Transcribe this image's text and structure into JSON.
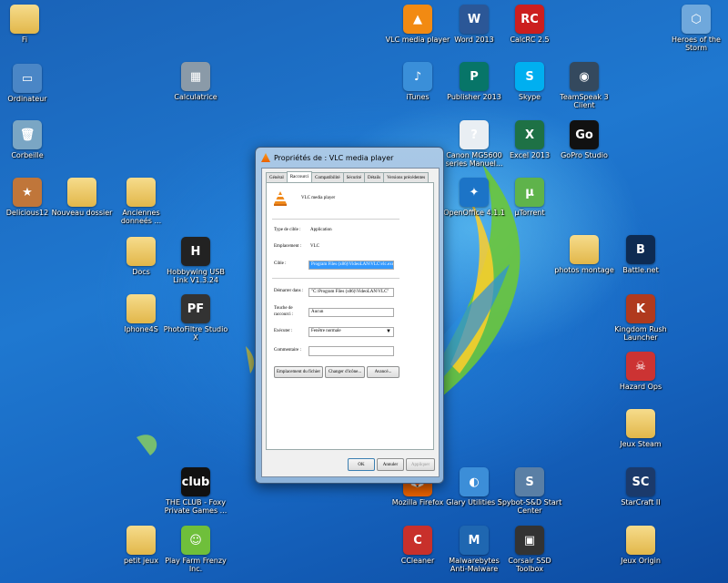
{
  "desktop": {
    "icons": [
      {
        "label": "Fi",
        "x": 0,
        "y": 0
      },
      {
        "label": "Ordinateur",
        "x": 0,
        "y": 0
      },
      {
        "label": "Corbeille",
        "x": 0,
        "y": 0
      },
      {
        "label": "Delicious12",
        "x": 0,
        "y": 0
      },
      {
        "label": "Nouveau dossier",
        "x": 0,
        "y": 0
      },
      {
        "label": "Anciennes donneés ...",
        "x": 0,
        "y": 0
      },
      {
        "label": "Docs",
        "x": 0,
        "y": 0
      },
      {
        "label": "Iphone4S",
        "x": 0,
        "y": 0
      },
      {
        "label": "Calculatrice",
        "x": 0,
        "y": 0
      },
      {
        "label": "Hobbywing USB Link V1.3.24",
        "x": 0,
        "y": 0
      },
      {
        "label": "PhotoFiltre Studio X",
        "x": 0,
        "y": 0
      },
      {
        "label": "VLC media player",
        "x": 0,
        "y": 0
      },
      {
        "label": "Word 2013",
        "x": 0,
        "y": 0
      },
      {
        "label": "CalcRC 2.5",
        "x": 0,
        "y": 0
      },
      {
        "label": "iTunes",
        "x": 0,
        "y": 0
      },
      {
        "label": "Publisher 2013",
        "x": 0,
        "y": 0
      },
      {
        "label": "Skype",
        "x": 0,
        "y": 0
      },
      {
        "label": "TeamSpeak 3 Client",
        "x": 0,
        "y": 0
      },
      {
        "label": "Canon MG5600 series Manuel...",
        "x": 0,
        "y": 0
      },
      {
        "label": "Excel 2013",
        "x": 0,
        "y": 0
      },
      {
        "label": "GoPro Studio",
        "x": 0,
        "y": 0
      },
      {
        "label": "OpenOffice 4.1.1",
        "x": 0,
        "y": 0
      },
      {
        "label": "µTorrent",
        "x": 0,
        "y": 0
      },
      {
        "label": "Heroes of the Storm",
        "x": 0,
        "y": 0
      },
      {
        "label": "photos montage",
        "x": 0,
        "y": 0
      },
      {
        "label": "Battle.net",
        "x": 0,
        "y": 0
      },
      {
        "label": "Kingdom Rush Launcher",
        "x": 0,
        "y": 0
      },
      {
        "label": "Hazard Ops",
        "x": 0,
        "y": 0
      },
      {
        "label": "Jeux Steam",
        "x": 0,
        "y": 0
      },
      {
        "label": "StarCraft II",
        "x": 0,
        "y": 0
      },
      {
        "label": "Jeux Origin",
        "x": 0,
        "y": 0
      },
      {
        "label": "THE CLUB - Foxy Private Games ...",
        "x": 0,
        "y": 0
      },
      {
        "label": "petit jeux",
        "x": 0,
        "y": 0
      },
      {
        "label": "Play Farm Frenzy Inc.",
        "x": 0,
        "y": 0
      },
      {
        "label": "Mozilla Firefox",
        "x": 0,
        "y": 0
      },
      {
        "label": "Glary Utilities 5",
        "x": 0,
        "y": 0
      },
      {
        "label": "Spybot-S&D Start Center",
        "x": 0,
        "y": 0
      },
      {
        "label": "CCleaner",
        "x": 0,
        "y": 0
      },
      {
        "label": "Malwarebytes Anti-Malware",
        "x": 0,
        "y": 0
      },
      {
        "label": "Corsair SSD Toolbox",
        "x": 0,
        "y": 0
      }
    ]
  },
  "dialog": {
    "title": "Propriétés de : VLC media player",
    "tabs": [
      "Général",
      "Raccourci",
      "Compatibilité",
      "Sécurité",
      "Détails",
      "Versions précédentes"
    ],
    "app_name": "VLC media player",
    "type_label": "Type de cible :",
    "type_value": "Application",
    "location_label": "Emplacement :",
    "location_value": "VLC",
    "target_label": "Cible :",
    "target_value": "Program Files (x86)\\VideoLAN\\VLC\\vlc.exe",
    "start_label": "Démarrer dans :",
    "start_value": "\"C:\\Program Files (x86)\\VideoLAN\\VLC\"",
    "shortcut_label": "Touche de raccourci :",
    "shortcut_value": "Aucun",
    "run_label": "Exécuter :",
    "run_value": "Fenêtre normale",
    "comment_label": "Commentaire :",
    "comment_value": "",
    "btn_location": "Emplacement du fichier",
    "btn_icon": "Changer d'icône...",
    "btn_advanced": "Avancé...",
    "btn_ok": "OK",
    "btn_cancel": "Annuler",
    "btn_apply": "Appliquer"
  }
}
